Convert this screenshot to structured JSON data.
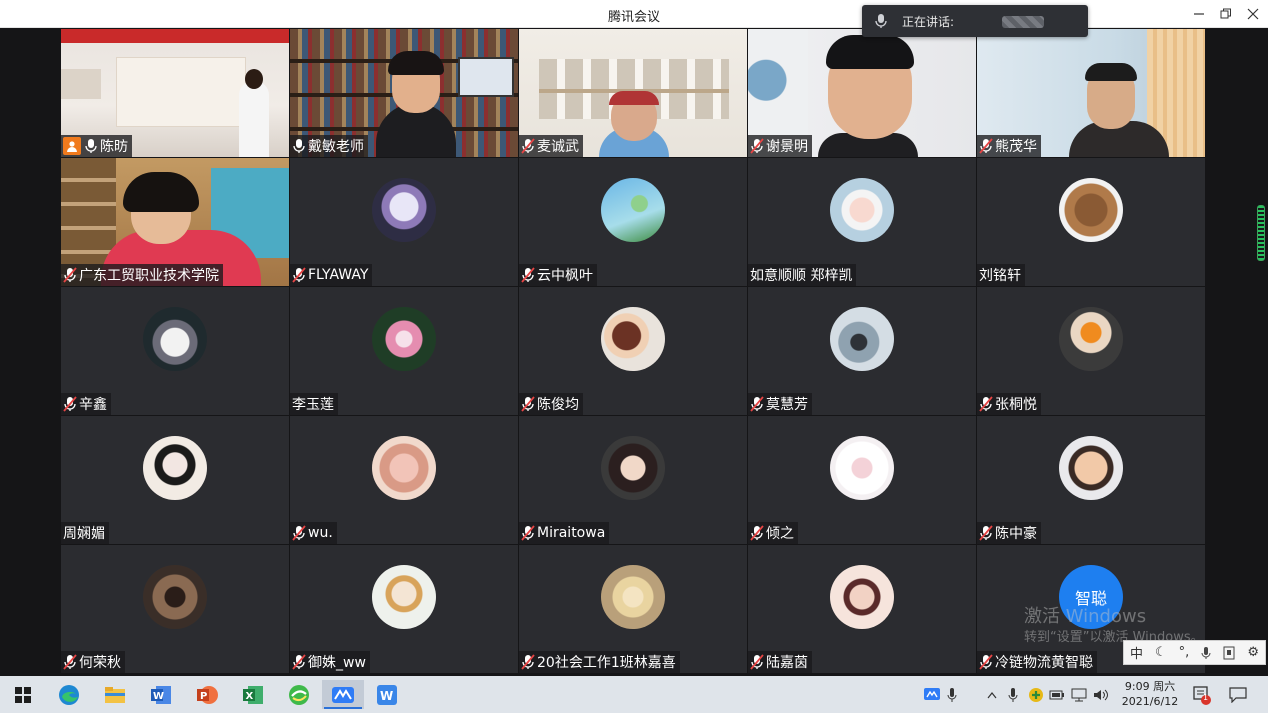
{
  "window": {
    "title": "腾讯会议"
  },
  "speaking": {
    "label": "正在讲话:"
  },
  "participants": [
    {
      "name": "陈昉",
      "mic": "on",
      "host": true
    },
    {
      "name": "戴敏老师",
      "mic": "on"
    },
    {
      "name": "麦诚武",
      "mic": "off"
    },
    {
      "name": "谢景明",
      "mic": "off"
    },
    {
      "name": "熊茂华",
      "mic": "off"
    },
    {
      "name": "广东工贸职业技术学院",
      "mic": "off"
    },
    {
      "name": "FLYAWAY",
      "mic": "off"
    },
    {
      "name": "云中枫叶",
      "mic": "off"
    },
    {
      "name": "如意顺顺  郑梓凯",
      "mic": "none"
    },
    {
      "name": "刘铭轩",
      "mic": "none"
    },
    {
      "name": "辛鑫",
      "mic": "off"
    },
    {
      "name": "李玉莲",
      "mic": "none"
    },
    {
      "name": "陈俊均",
      "mic": "off"
    },
    {
      "name": "莫慧芳",
      "mic": "off"
    },
    {
      "name": "张桐悦",
      "mic": "off"
    },
    {
      "name": "周娴媚",
      "mic": "none"
    },
    {
      "name": "wu.",
      "mic": "off"
    },
    {
      "name": "Miraitowa",
      "mic": "off"
    },
    {
      "name": "倾之",
      "mic": "off"
    },
    {
      "name": "陈中豪",
      "mic": "off"
    },
    {
      "name": "何荣秋",
      "mic": "off"
    },
    {
      "name": "御姝_ww",
      "mic": "off"
    },
    {
      "name": "20社会工作1班林嘉喜",
      "mic": "off"
    },
    {
      "name": "陆嘉茵",
      "mic": "off"
    },
    {
      "name": "冷链物流黄智聪",
      "mic": "off",
      "avatar_text": "智聪"
    }
  ],
  "watermark": {
    "line1": "激活 Windows",
    "line2": "转到“设置”以激活 Windows。"
  },
  "ime": {
    "mode": "中"
  },
  "taskbar": {
    "time": "9:09 周六",
    "date": "2021/6/12",
    "notification_count": "1"
  },
  "colors": {
    "host": "#f07a1d",
    "mic_off": "#e64545",
    "accent": "#2b71d8"
  }
}
